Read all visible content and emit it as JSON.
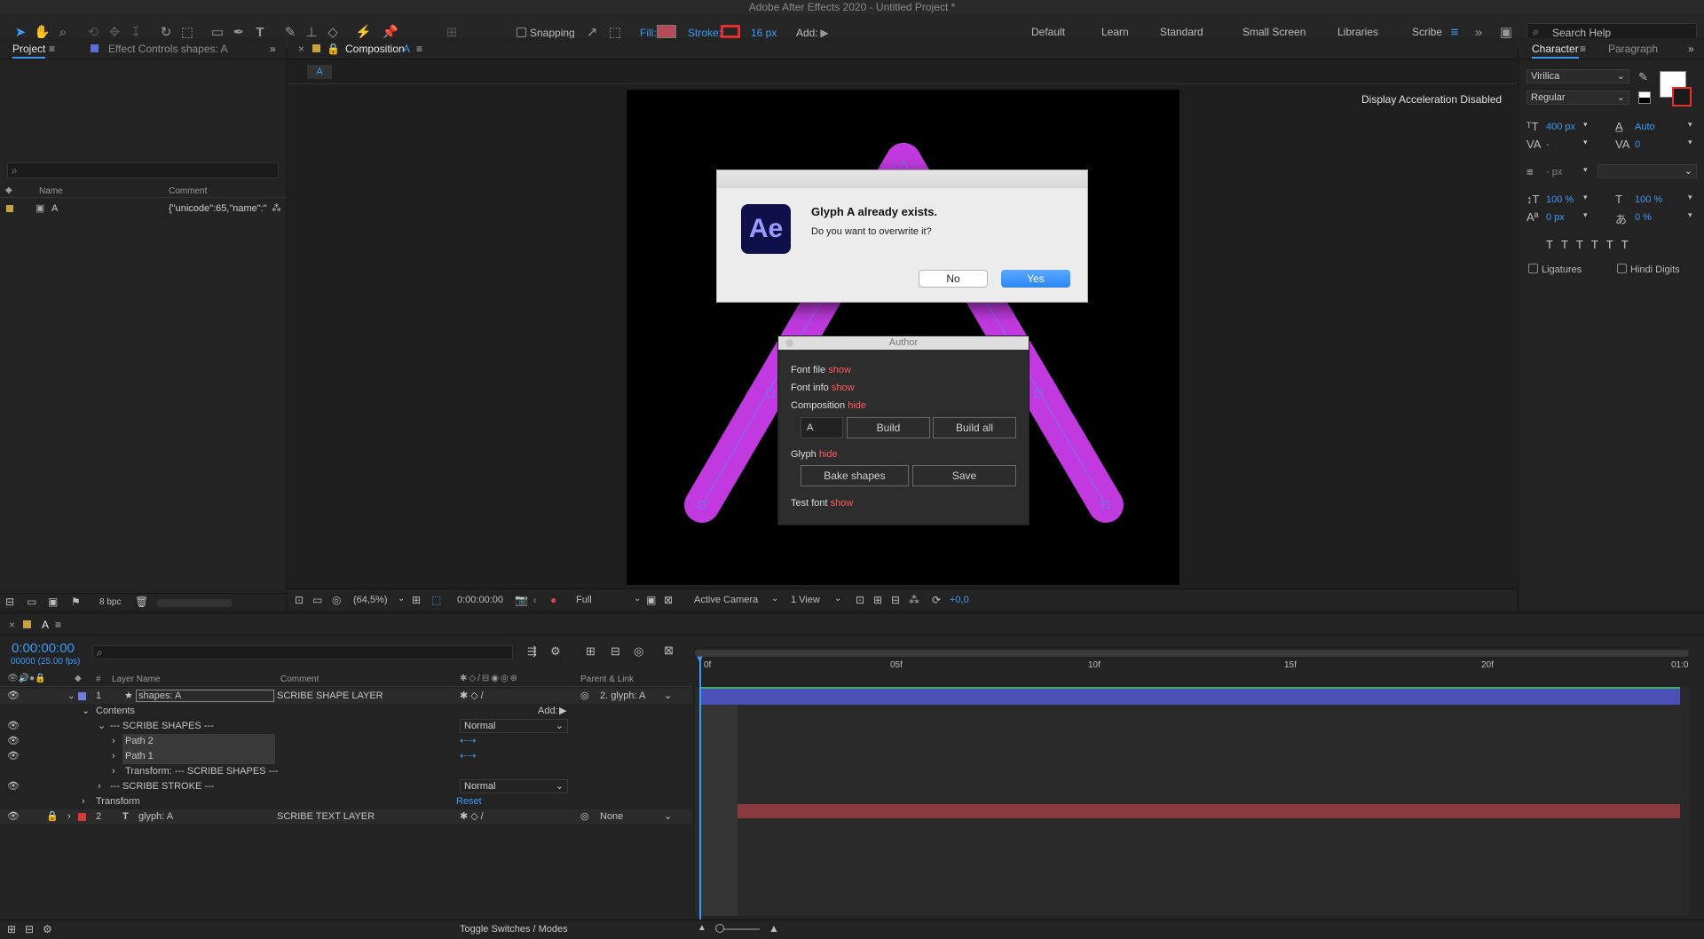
{
  "titlebar": "Adobe After Effects 2020 - Untitled Project *",
  "toolbar": {
    "snapping": "Snapping",
    "fill": "Fill:",
    "stroke": "Stroke:",
    "stroke_px": "16 px",
    "add": "Add:",
    "fill_color": "#b54b56",
    "stroke_color": "#e23030"
  },
  "workspaces": [
    "Default",
    "Learn",
    "Standard",
    "Small Screen",
    "Libraries",
    "Scribe"
  ],
  "search_help": "Search Help",
  "project": {
    "tab_project": "Project",
    "tab_effect": "Effect Controls shapes: A",
    "col_name": "Name",
    "col_comment": "Comment",
    "item_name": "A",
    "item_comment": "{\"unicode\":65,\"name\":\"",
    "bpc": "8 bpc"
  },
  "comp": {
    "tab": "Composition",
    "tab_name": "A",
    "crumb": "A",
    "accel": "Display Acceleration Disabled",
    "zoom": "(64,5%)",
    "time": "0:00:00:00",
    "resolution": "Full",
    "camera": "Active Camera",
    "views": "1 View",
    "exposure": "+0,0"
  },
  "dialog": {
    "logo": "Ae",
    "title": "Glyph A already exists.",
    "message": "Do you want to overwrite it?",
    "no": "No",
    "yes": "Yes"
  },
  "author": {
    "title": "Author",
    "font_file": "Font file",
    "font_info": "Font info",
    "composition": "Composition",
    "glyph": "Glyph",
    "test_font": "Test font",
    "show": "show",
    "hide": "hide",
    "comp_input": "A",
    "build": "Build",
    "build_all": "Build all",
    "bake": "Bake shapes",
    "save": "Save"
  },
  "character": {
    "tab_character": "Character",
    "tab_paragraph": "Paragraph",
    "font": "Virilica",
    "style": "Regular",
    "size": "400 px",
    "leading": "Auto",
    "kerning": "-",
    "tracking": "0",
    "stroke_width": "- px",
    "vscale": "100 %",
    "hscale": "100 %",
    "baseline": "0 px",
    "tsume": "0 %",
    "ligatures": "Ligatures",
    "hindi": "Hindi Digits"
  },
  "timeline": {
    "tab": "A",
    "timecode": "0:00:00:00",
    "frames": "00000 (25.00 fps)",
    "col_layer": "Layer Name",
    "col_comment": "Comment",
    "col_parent": "Parent & Link",
    "ruler": [
      "0f",
      "05f",
      "10f",
      "15f",
      "20f",
      "01:0"
    ],
    "layer1": {
      "num": "1",
      "name": "shapes: A",
      "comment": "SCRIBE SHAPE LAYER",
      "parent": "2. glyph: A"
    },
    "contents": "Contents",
    "add": "Add:",
    "scribe_shapes": "--- SCRIBE SHAPES ---",
    "path2": "Path 2",
    "path1": "Path 1",
    "transform_shapes": "Transform: --- SCRIBE SHAPES ---",
    "scribe_stroke": "--- SCRIBE STROKE ---",
    "transform": "Transform",
    "reset": "Reset",
    "blend_normal": "Normal",
    "layer2": {
      "num": "2",
      "name": "glyph: A",
      "comment": "SCRIBE TEXT LAYER",
      "parent": "None"
    },
    "toggle": "Toggle Switches / Modes",
    "layer1_color": "#6f7fe0",
    "layer2_color": "#d83a3a"
  }
}
